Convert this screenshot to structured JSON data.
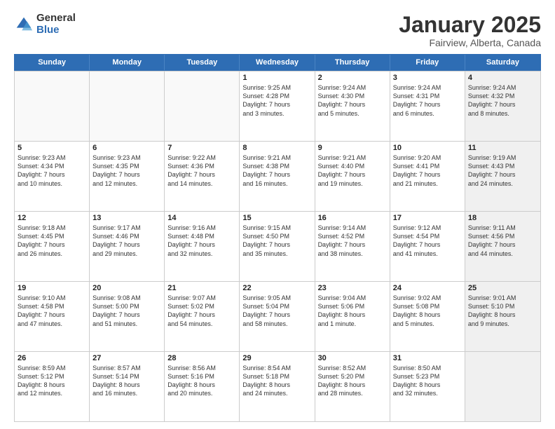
{
  "logo": {
    "general": "General",
    "blue": "Blue"
  },
  "title": "January 2025",
  "subtitle": "Fairview, Alberta, Canada",
  "days": [
    "Sunday",
    "Monday",
    "Tuesday",
    "Wednesday",
    "Thursday",
    "Friday",
    "Saturday"
  ],
  "weeks": [
    [
      {
        "day": "",
        "content": "",
        "empty": true
      },
      {
        "day": "",
        "content": "",
        "empty": true
      },
      {
        "day": "",
        "content": "",
        "empty": true
      },
      {
        "day": "1",
        "content": "Sunrise: 9:25 AM\nSunset: 4:28 PM\nDaylight: 7 hours\nand 3 minutes."
      },
      {
        "day": "2",
        "content": "Sunrise: 9:24 AM\nSunset: 4:30 PM\nDaylight: 7 hours\nand 5 minutes."
      },
      {
        "day": "3",
        "content": "Sunrise: 9:24 AM\nSunset: 4:31 PM\nDaylight: 7 hours\nand 6 minutes."
      },
      {
        "day": "4",
        "content": "Sunrise: 9:24 AM\nSunset: 4:32 PM\nDaylight: 7 hours\nand 8 minutes.",
        "shaded": true
      }
    ],
    [
      {
        "day": "5",
        "content": "Sunrise: 9:23 AM\nSunset: 4:34 PM\nDaylight: 7 hours\nand 10 minutes."
      },
      {
        "day": "6",
        "content": "Sunrise: 9:23 AM\nSunset: 4:35 PM\nDaylight: 7 hours\nand 12 minutes."
      },
      {
        "day": "7",
        "content": "Sunrise: 9:22 AM\nSunset: 4:36 PM\nDaylight: 7 hours\nand 14 minutes."
      },
      {
        "day": "8",
        "content": "Sunrise: 9:21 AM\nSunset: 4:38 PM\nDaylight: 7 hours\nand 16 minutes."
      },
      {
        "day": "9",
        "content": "Sunrise: 9:21 AM\nSunset: 4:40 PM\nDaylight: 7 hours\nand 19 minutes."
      },
      {
        "day": "10",
        "content": "Sunrise: 9:20 AM\nSunset: 4:41 PM\nDaylight: 7 hours\nand 21 minutes."
      },
      {
        "day": "11",
        "content": "Sunrise: 9:19 AM\nSunset: 4:43 PM\nDaylight: 7 hours\nand 24 minutes.",
        "shaded": true
      }
    ],
    [
      {
        "day": "12",
        "content": "Sunrise: 9:18 AM\nSunset: 4:45 PM\nDaylight: 7 hours\nand 26 minutes."
      },
      {
        "day": "13",
        "content": "Sunrise: 9:17 AM\nSunset: 4:46 PM\nDaylight: 7 hours\nand 29 minutes."
      },
      {
        "day": "14",
        "content": "Sunrise: 9:16 AM\nSunset: 4:48 PM\nDaylight: 7 hours\nand 32 minutes."
      },
      {
        "day": "15",
        "content": "Sunrise: 9:15 AM\nSunset: 4:50 PM\nDaylight: 7 hours\nand 35 minutes."
      },
      {
        "day": "16",
        "content": "Sunrise: 9:14 AM\nSunset: 4:52 PM\nDaylight: 7 hours\nand 38 minutes."
      },
      {
        "day": "17",
        "content": "Sunrise: 9:12 AM\nSunset: 4:54 PM\nDaylight: 7 hours\nand 41 minutes."
      },
      {
        "day": "18",
        "content": "Sunrise: 9:11 AM\nSunset: 4:56 PM\nDaylight: 7 hours\nand 44 minutes.",
        "shaded": true
      }
    ],
    [
      {
        "day": "19",
        "content": "Sunrise: 9:10 AM\nSunset: 4:58 PM\nDaylight: 7 hours\nand 47 minutes."
      },
      {
        "day": "20",
        "content": "Sunrise: 9:08 AM\nSunset: 5:00 PM\nDaylight: 7 hours\nand 51 minutes."
      },
      {
        "day": "21",
        "content": "Sunrise: 9:07 AM\nSunset: 5:02 PM\nDaylight: 7 hours\nand 54 minutes."
      },
      {
        "day": "22",
        "content": "Sunrise: 9:05 AM\nSunset: 5:04 PM\nDaylight: 7 hours\nand 58 minutes."
      },
      {
        "day": "23",
        "content": "Sunrise: 9:04 AM\nSunset: 5:06 PM\nDaylight: 8 hours\nand 1 minute."
      },
      {
        "day": "24",
        "content": "Sunrise: 9:02 AM\nSunset: 5:08 PM\nDaylight: 8 hours\nand 5 minutes."
      },
      {
        "day": "25",
        "content": "Sunrise: 9:01 AM\nSunset: 5:10 PM\nDaylight: 8 hours\nand 9 minutes.",
        "shaded": true
      }
    ],
    [
      {
        "day": "26",
        "content": "Sunrise: 8:59 AM\nSunset: 5:12 PM\nDaylight: 8 hours\nand 12 minutes."
      },
      {
        "day": "27",
        "content": "Sunrise: 8:57 AM\nSunset: 5:14 PM\nDaylight: 8 hours\nand 16 minutes."
      },
      {
        "day": "28",
        "content": "Sunrise: 8:56 AM\nSunset: 5:16 PM\nDaylight: 8 hours\nand 20 minutes."
      },
      {
        "day": "29",
        "content": "Sunrise: 8:54 AM\nSunset: 5:18 PM\nDaylight: 8 hours\nand 24 minutes."
      },
      {
        "day": "30",
        "content": "Sunrise: 8:52 AM\nSunset: 5:20 PM\nDaylight: 8 hours\nand 28 minutes."
      },
      {
        "day": "31",
        "content": "Sunrise: 8:50 AM\nSunset: 5:23 PM\nDaylight: 8 hours\nand 32 minutes."
      },
      {
        "day": "",
        "content": "",
        "empty": true,
        "shaded": true
      }
    ]
  ]
}
